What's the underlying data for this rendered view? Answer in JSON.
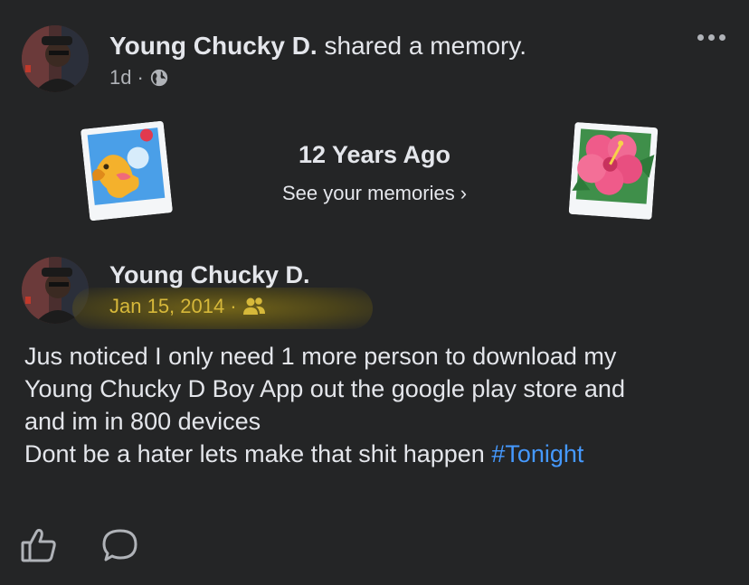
{
  "header": {
    "author_name": "Young Chucky D.",
    "action_text": "shared a memory.",
    "time": "1d",
    "separator": "·",
    "audience_icon": "globe-icon",
    "more_icon": "more-options-icon"
  },
  "memories": {
    "title": "12 Years Ago",
    "link_label": "See your memories",
    "link_chevron": "›",
    "left_card_icon": "dog-photo-icon",
    "right_card_icon": "hibiscus-photo-icon"
  },
  "post": {
    "author_name": "Young Chucky D.",
    "date": "Jan 15, 2014",
    "separator": "·",
    "audience_icon": "friends-icon",
    "body_line1": "Jus noticed I only need 1 more person to download my",
    "body_line2": "Young Chucky D Boy App out the google play store and",
    "body_line3": "and im in 800 devices",
    "body_line4": "Dont be a hater lets make that shit happen ",
    "hashtag": "#Tonight"
  },
  "actions": {
    "like_icon": "like-icon",
    "comment_icon": "comment-icon"
  },
  "colors": {
    "background": "#242526",
    "primary_text": "#e4e6eb",
    "secondary_text": "#b0b3b8",
    "hashtag": "#4599ff",
    "highlight": "#d6b83a"
  }
}
